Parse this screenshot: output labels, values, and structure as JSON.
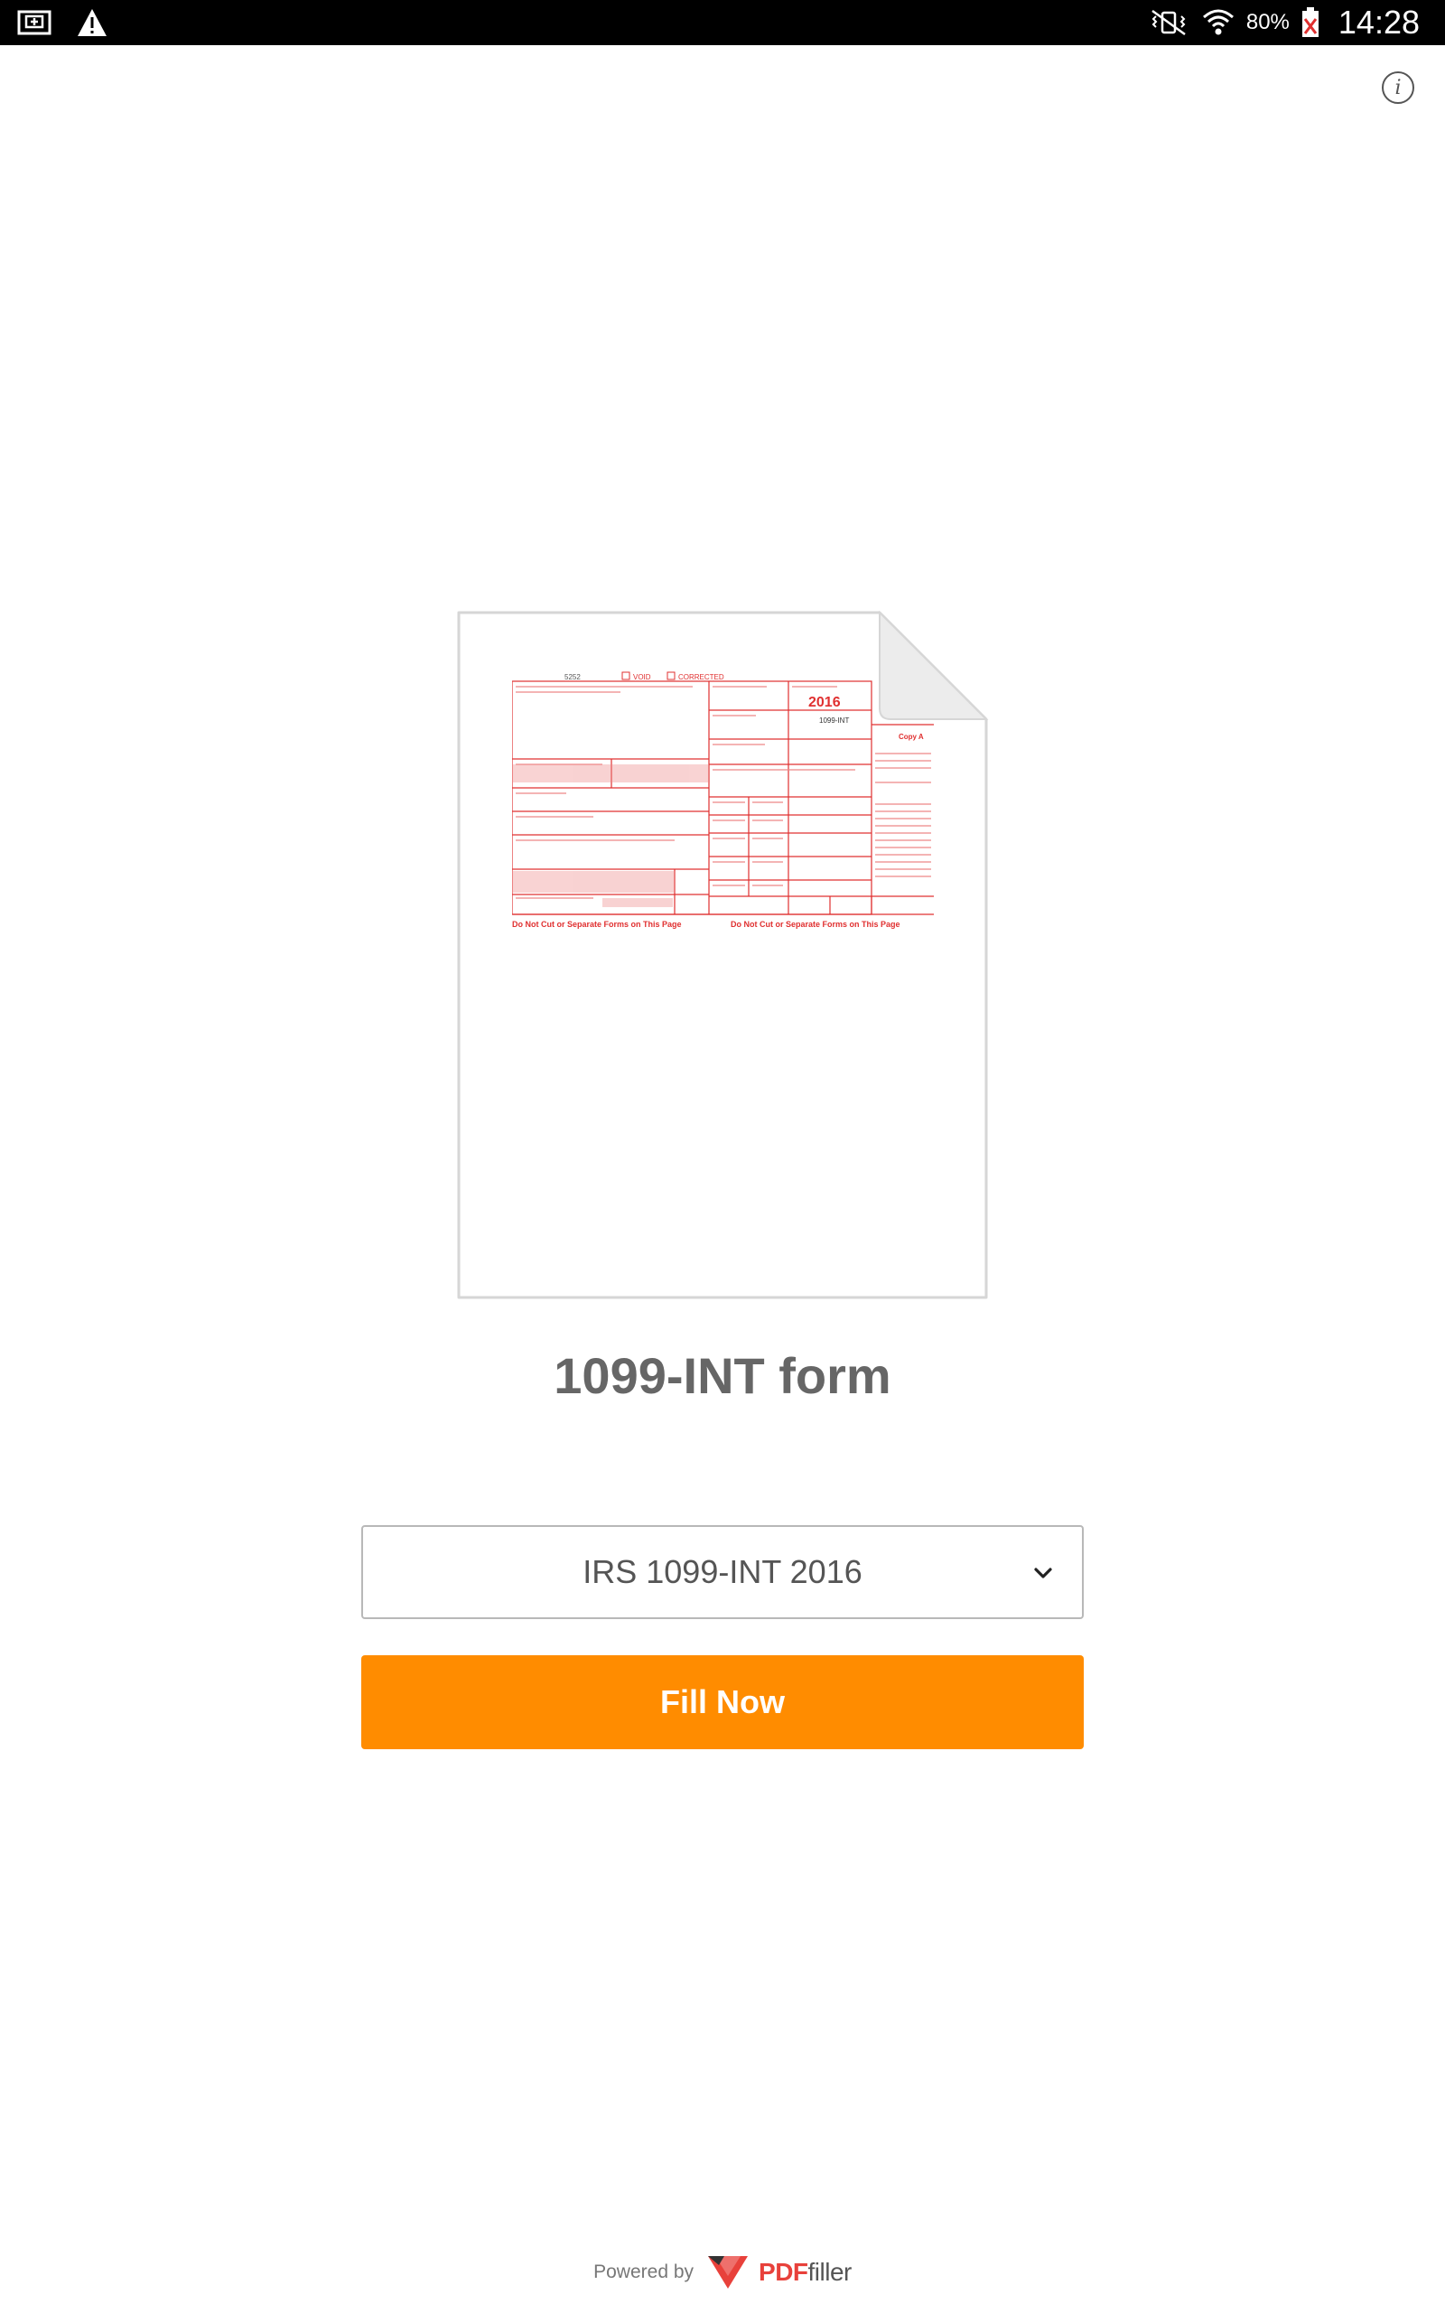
{
  "status_bar": {
    "battery_percent": "80%",
    "time": "14:28",
    "icons": [
      "gallery-icon",
      "warning-icon",
      "vibrate-icon",
      "wifi-icon",
      "battery-icon"
    ]
  },
  "info": {
    "icon": "info-icon",
    "glyph": "i"
  },
  "preview": {
    "form_number": "5252",
    "void_label": "VOID",
    "corrected_label": "CORRECTED",
    "year": "2016",
    "form_code": "1099-INT",
    "copy_label": "Copy A",
    "footer_text": "Do Not Cut or Separate Forms on This Page"
  },
  "main": {
    "title": "1099-INT form",
    "select_value": "IRS 1099-INT 2016",
    "fill_button_label": "Fill Now"
  },
  "footer": {
    "powered_by": "Powered by",
    "brand_pdf": "PDF",
    "brand_filler": "filler"
  },
  "colors": {
    "accent": "#ff8c00",
    "form_red": "#e03030",
    "brand_red": "#e8413b"
  }
}
